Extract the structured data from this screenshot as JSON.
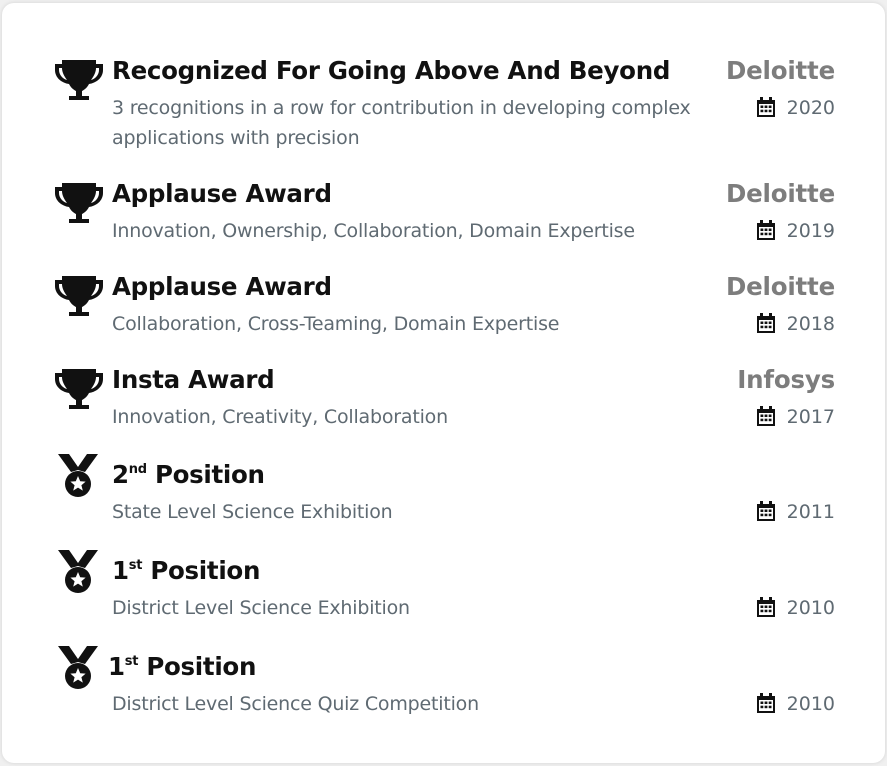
{
  "awards": [
    {
      "icon": "trophy-icon",
      "title": "Recognized For Going Above And Beyond",
      "description": "3 recognitions in a row for contribution in developing complex applications with precision",
      "org": "Deloitte",
      "year": "2020"
    },
    {
      "icon": "trophy-icon",
      "title": "Applause Award",
      "description": "Innovation, Ownership, Collaboration, Domain Expertise",
      "org": "Deloitte",
      "year": "2019"
    },
    {
      "icon": "trophy-icon",
      "title": "Applause Award",
      "description": "Collaboration, Cross-Teaming, Domain Expertise",
      "org": "Deloitte",
      "year": "2018"
    },
    {
      "icon": "trophy-icon",
      "title": "Insta Award",
      "description": "Innovation, Creativity, Collaboration",
      "org": "Infosys",
      "year": "2017"
    },
    {
      "icon": "medal-icon",
      "title_num": "2",
      "title_sup": "nd",
      "title_rest": " Position",
      "description": "State Level Science Exhibition",
      "year": "2011"
    },
    {
      "icon": "medal-icon",
      "title_num": "1",
      "title_sup": "st",
      "title_rest": " Position",
      "description": "District Level Science Exhibition",
      "year": "2010"
    },
    {
      "icon": "medal-icon",
      "title_num": "1",
      "title_sup": "st",
      "title_rest": " Position",
      "description": "District Level Science Quiz Competition",
      "year": "2010"
    }
  ]
}
